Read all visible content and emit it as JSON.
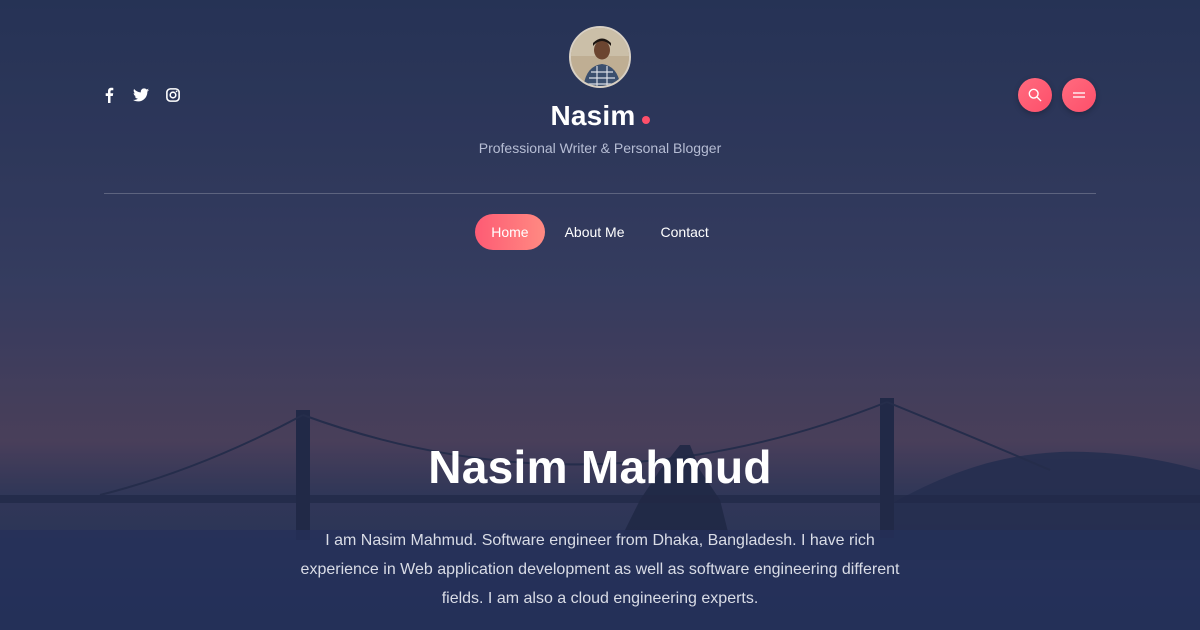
{
  "header": {
    "site_title": "Nasim",
    "tagline": "Professional Writer & Personal Blogger",
    "avatar_icon": "person-avatar"
  },
  "social": [
    {
      "name": "facebook",
      "icon": "facebook-icon"
    },
    {
      "name": "twitter",
      "icon": "twitter-icon"
    },
    {
      "name": "instagram",
      "icon": "instagram-icon"
    }
  ],
  "actions": {
    "search_icon": "search-icon",
    "menu_icon": "menu-icon"
  },
  "nav": {
    "items": [
      "Home",
      "About Me",
      "Contact"
    ],
    "active": "Home"
  },
  "hero": {
    "title": "Nasim Mahmud",
    "description": "I am Nasim Mahmud. Software engineer from Dhaka, Bangladesh. I have rich experience in Web application development as well as software engineering different fields. I am also a cloud engineering experts."
  },
  "colors": {
    "accent": "#fe4f6a",
    "background": "#2c3a5c",
    "text": "#ffffff"
  }
}
